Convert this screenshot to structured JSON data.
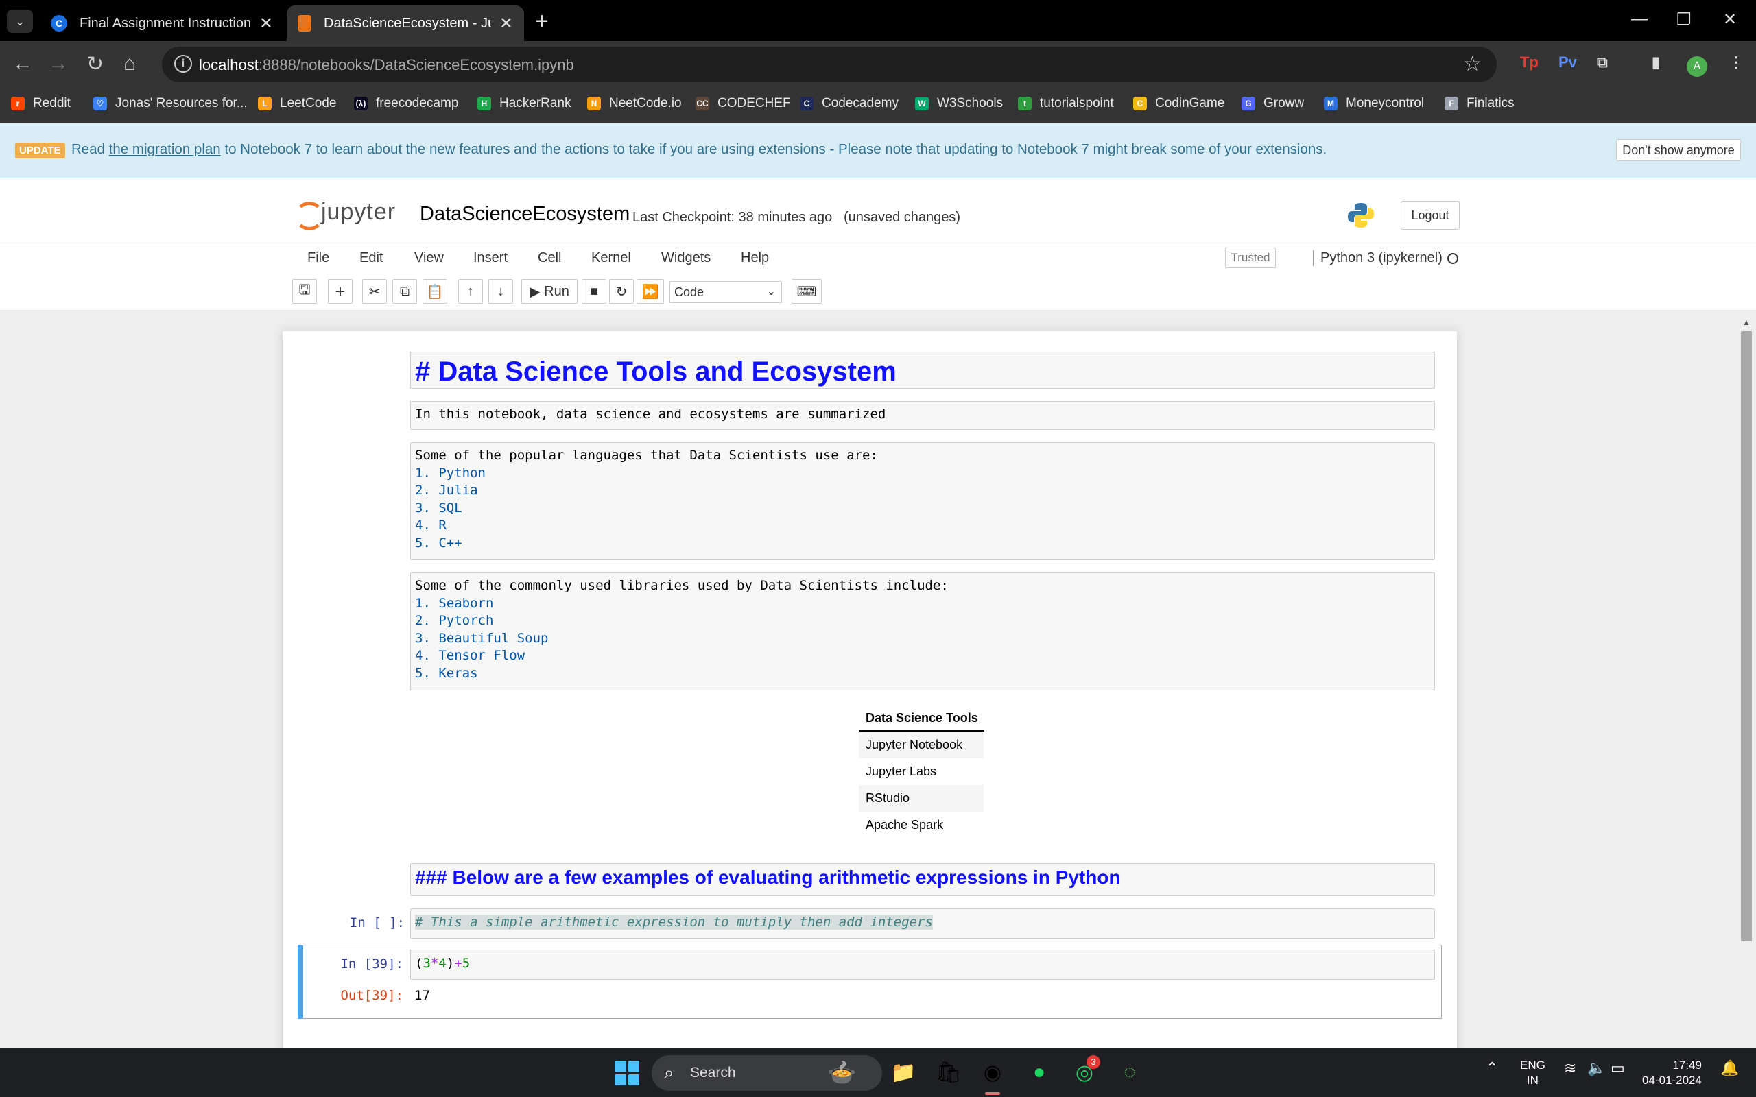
{
  "browser": {
    "tabs": [
      {
        "title": "Final Assignment Instructions: C",
        "favicon": "C"
      },
      {
        "title": "DataScienceEcosystem - Jupyter",
        "favicon": ""
      }
    ],
    "url_host": "localhost",
    "url_rest": ":8888/notebooks/DataScienceEcosystem.ipynb",
    "profile_initial": "A",
    "extensions": [
      "Tp",
      "Pv"
    ],
    "bookmarks": [
      {
        "label": "Reddit",
        "color": "#ff4500",
        "glyph": "r"
      },
      {
        "label": "Jonas' Resources for...",
        "color": "#3b82f6",
        "glyph": "♡"
      },
      {
        "label": "LeetCode",
        "color": "#ffa116",
        "glyph": "L"
      },
      {
        "label": "freecodecamp",
        "color": "#0a0a23",
        "glyph": "(λ)"
      },
      {
        "label": "HackerRank",
        "color": "#1ba94c",
        "glyph": "H"
      },
      {
        "label": "NeetCode.io",
        "color": "#f59e0b",
        "glyph": "N"
      },
      {
        "label": "CODECHEF",
        "color": "#5b4638",
        "glyph": "CC"
      },
      {
        "label": "Codecademy",
        "color": "#1f2a5a",
        "glyph": "C"
      },
      {
        "label": "W3Schools",
        "color": "#04aa6d",
        "glyph": "W"
      },
      {
        "label": "tutorialspoint",
        "color": "#2e9e3f",
        "glyph": "t"
      },
      {
        "label": "CodinGame",
        "color": "#f2bb13",
        "glyph": "C"
      },
      {
        "label": "Groww",
        "color": "#5367ff",
        "glyph": "G"
      },
      {
        "label": "Moneycontrol",
        "color": "#2a6fdb",
        "glyph": "M"
      },
      {
        "label": "Finlatics",
        "color": "#9ca3af",
        "glyph": "F"
      }
    ]
  },
  "banner": {
    "badge": "UPDATE",
    "text_before": "Read ",
    "link": "the migration plan",
    "text_after": " to Notebook 7 to learn about the new features and the actions to take if you are using extensions - Please note that updating to Notebook 7 might break some of your extensions.",
    "dismiss": "Don't show anymore"
  },
  "header": {
    "logo_text": "jupyter",
    "notebook_name": "DataScienceEcosystem",
    "checkpoint": "Last Checkpoint: 38 minutes ago",
    "unsaved": "(unsaved changes)",
    "logout": "Logout"
  },
  "menu": [
    "File",
    "Edit",
    "View",
    "Insert",
    "Cell",
    "Kernel",
    "Widgets",
    "Help"
  ],
  "kernel": {
    "trusted": "Trusted",
    "name": "Python 3 (ipykernel)"
  },
  "toolbar": {
    "run": "Run",
    "cell_type": "Code"
  },
  "cells": {
    "title": "# Data Science Tools and Ecosystem",
    "intro": "In this notebook, data science and ecosystems are summarized",
    "languages_heading": "Some of the popular languages that Data Scientists use are:",
    "languages": [
      "1. Python",
      "2. Julia",
      "3. SQL",
      "4. R",
      "5. C++"
    ],
    "libraries_heading": "Some of the commonly used libraries used by Data Scientists include:",
    "libraries": [
      "1. Seaborn",
      "2. Pytorch",
      "3. Beautiful Soup",
      "4. Tensor Flow",
      "5. Keras"
    ],
    "table_header": "Data Science Tools",
    "table_rows": [
      "Jupyter Notebook",
      "Jupyter Labs",
      "RStudio",
      "Apache Spark"
    ],
    "arith_heading": "### Below are a few examples of evaluating arithmetic expressions in Python",
    "code1_prompt": "In [ ]:",
    "code1": "# This a simple arithmetic expression to mutiply then add integers",
    "code2_prompt": "In [39]:",
    "code2_parts": [
      "(",
      "3",
      "*",
      "4",
      ")",
      "+",
      "5"
    ],
    "out_prompt": "Out[39]:",
    "output": "17"
  },
  "taskbar": {
    "search": "Search",
    "whatsapp_badge": "3",
    "lang1": "ENG",
    "lang2": "IN",
    "time": "17:49",
    "date": "04-01-2024"
  }
}
